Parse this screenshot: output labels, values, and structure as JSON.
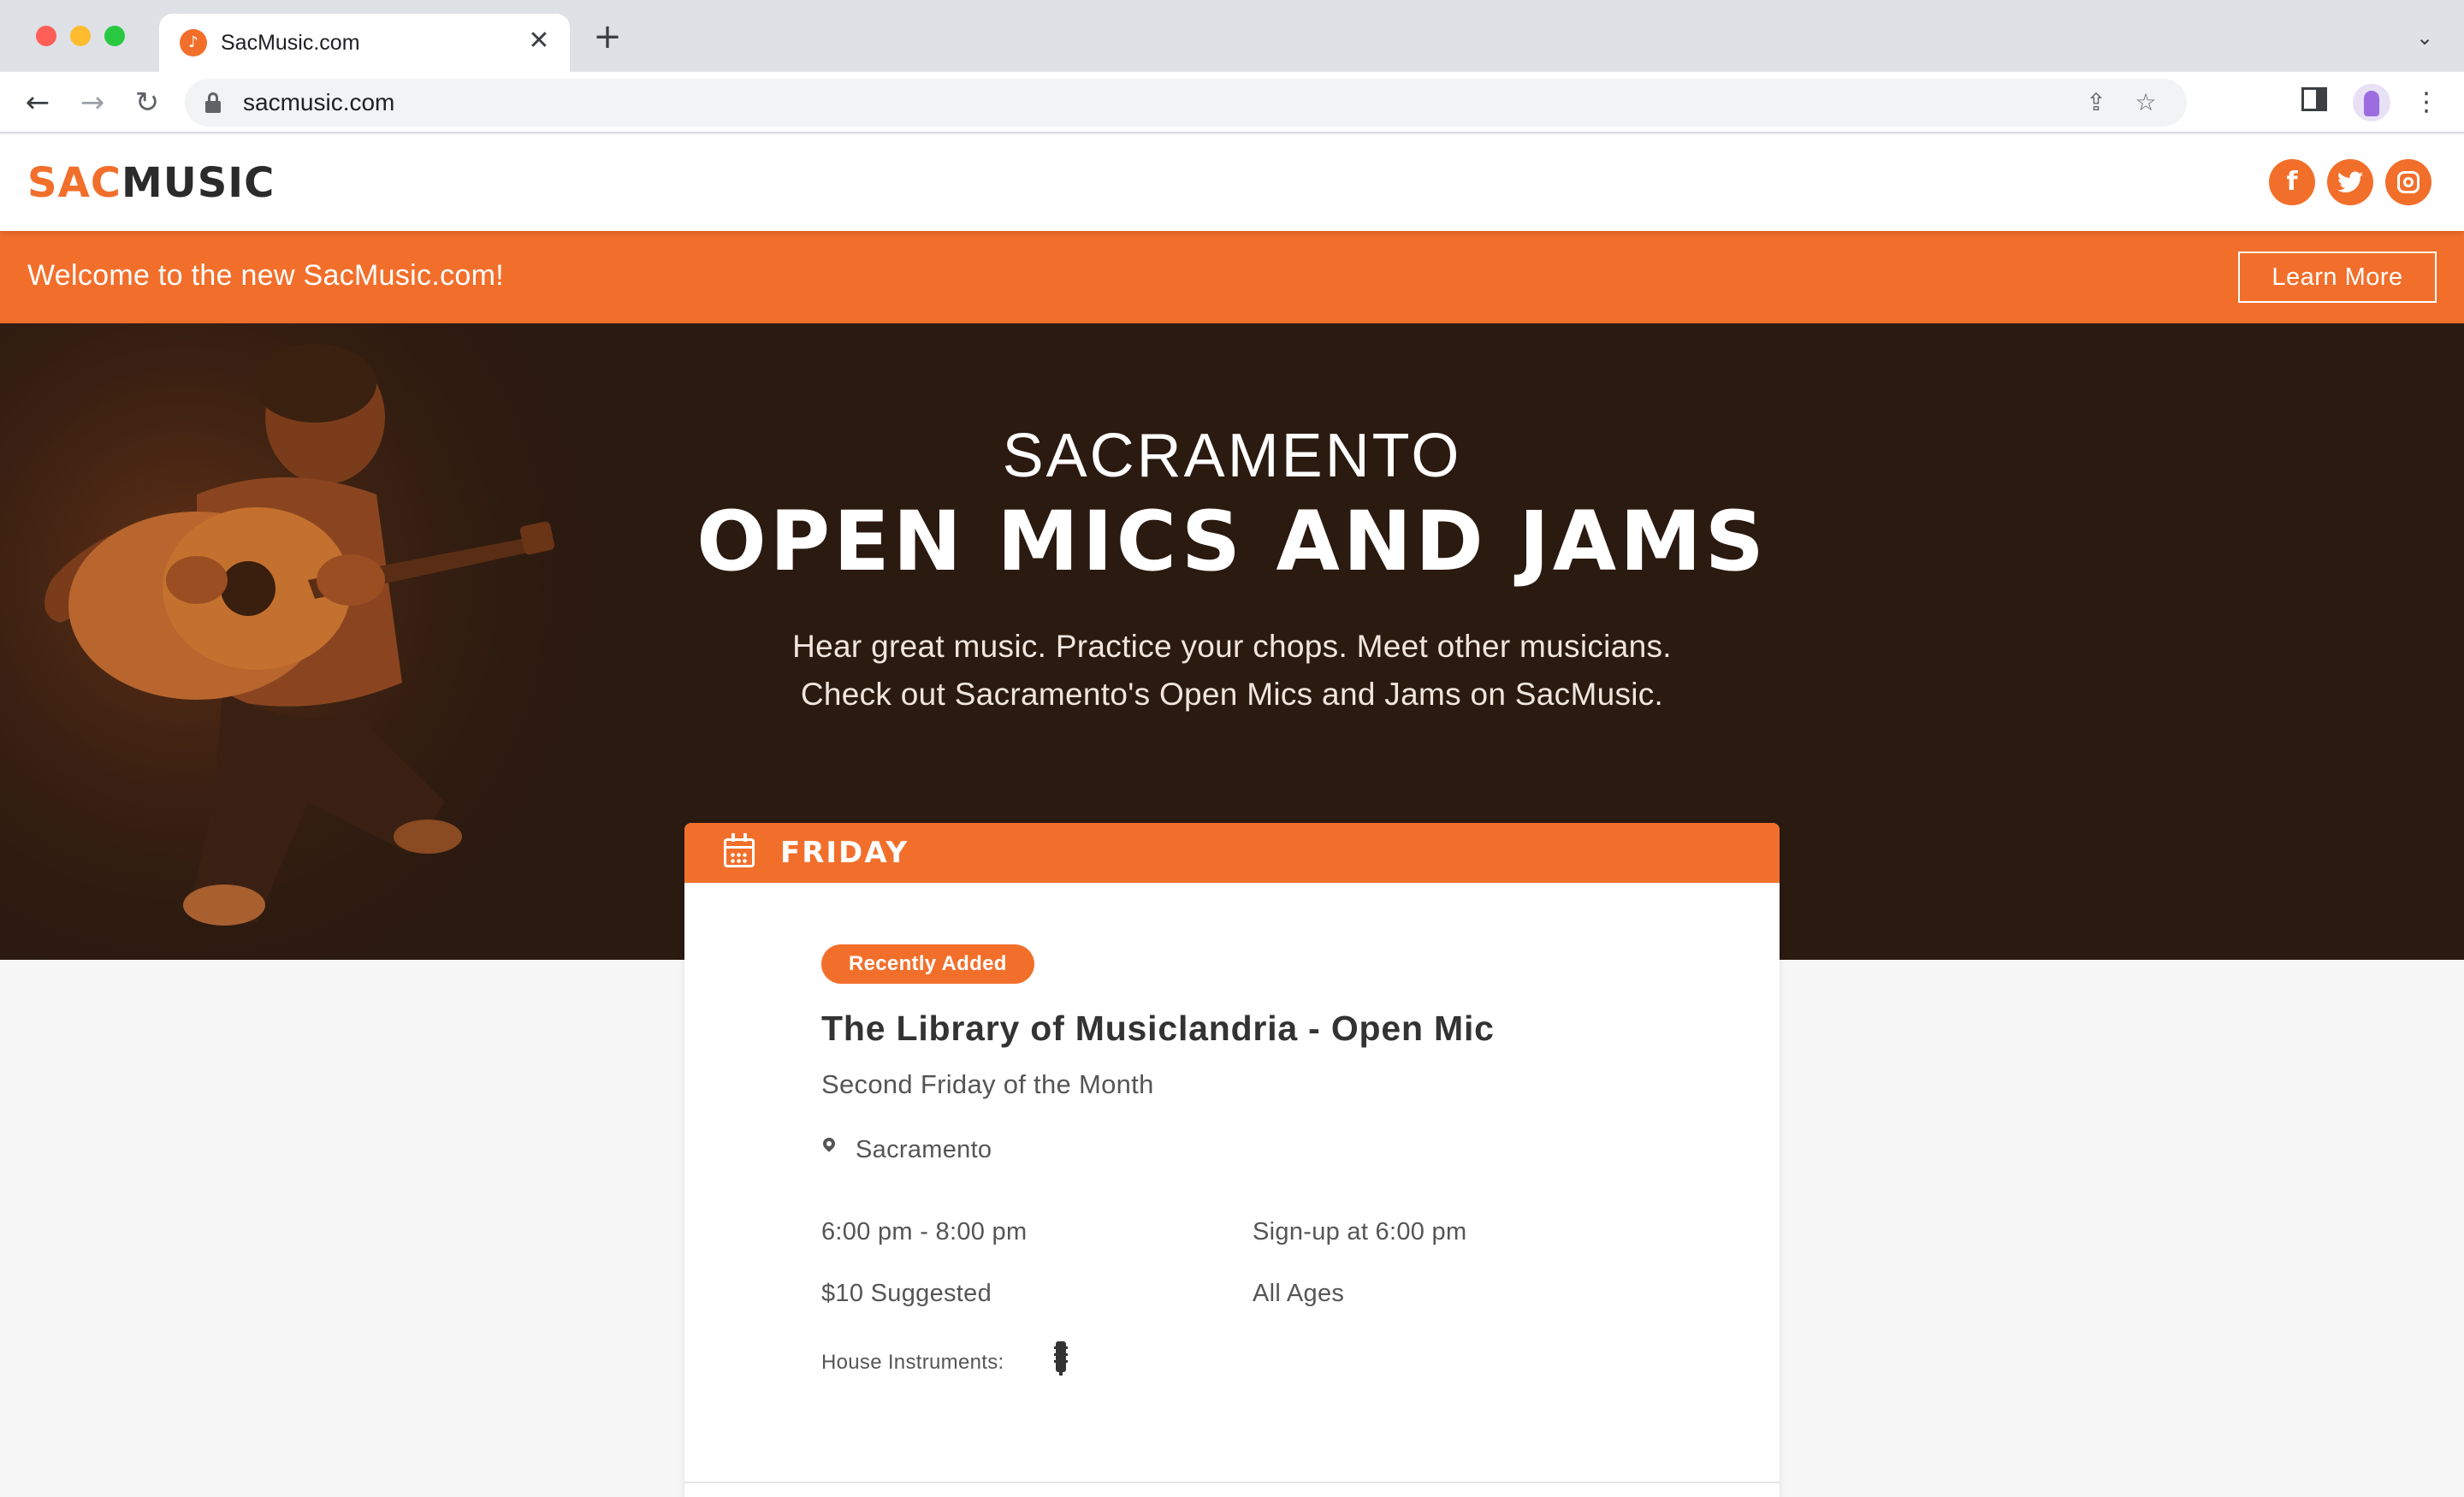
{
  "browser": {
    "tab_title": "SacMusic.com",
    "url": "sacmusic.com",
    "tab_close_glyph": "✕",
    "new_tab_glyph": "+",
    "tab_list_glyph": "⌄",
    "back_glyph": "←",
    "forward_glyph": "→",
    "reload_glyph": "↻",
    "share_glyph": "⇪",
    "star_glyph": "☆",
    "menu_glyph": "⋮"
  },
  "header": {
    "logo_sac": "SAC",
    "logo_music": "MUSIC",
    "social": [
      {
        "name": "facebook-icon",
        "glyph": "f"
      },
      {
        "name": "twitter-icon",
        "glyph": "🐦"
      },
      {
        "name": "instagram-icon",
        "glyph": ""
      }
    ]
  },
  "banner": {
    "text": "Welcome to the new SacMusic.com!",
    "button_label": "Learn More"
  },
  "hero": {
    "subtitle": "SACRAMENTO",
    "title": "OPEN MICS AND JAMS",
    "description_line1": "Hear great music. Practice your chops. Meet other musicians.",
    "description_line2": "Check out Sacramento's Open Mics and Jams on SacMusic."
  },
  "event_card": {
    "day": "FRIDAY",
    "badge": "Recently Added",
    "title": "The Library of Musiclandria - Open Mic",
    "recurrence": "Second Friday of the Month",
    "location": "Sacramento",
    "time": "6:00 pm - 8:00 pm",
    "signup": "Sign-up at 6:00 pm",
    "price": "$10 Suggested",
    "ages": "All Ages",
    "house_instruments_label": "House Instruments:",
    "house_instruments": [
      "guitar-icon"
    ]
  },
  "colors": {
    "brand_orange": "#f26f2b",
    "hero_bg": "#2b1a10",
    "logo_dark": "#2b2b2b"
  }
}
